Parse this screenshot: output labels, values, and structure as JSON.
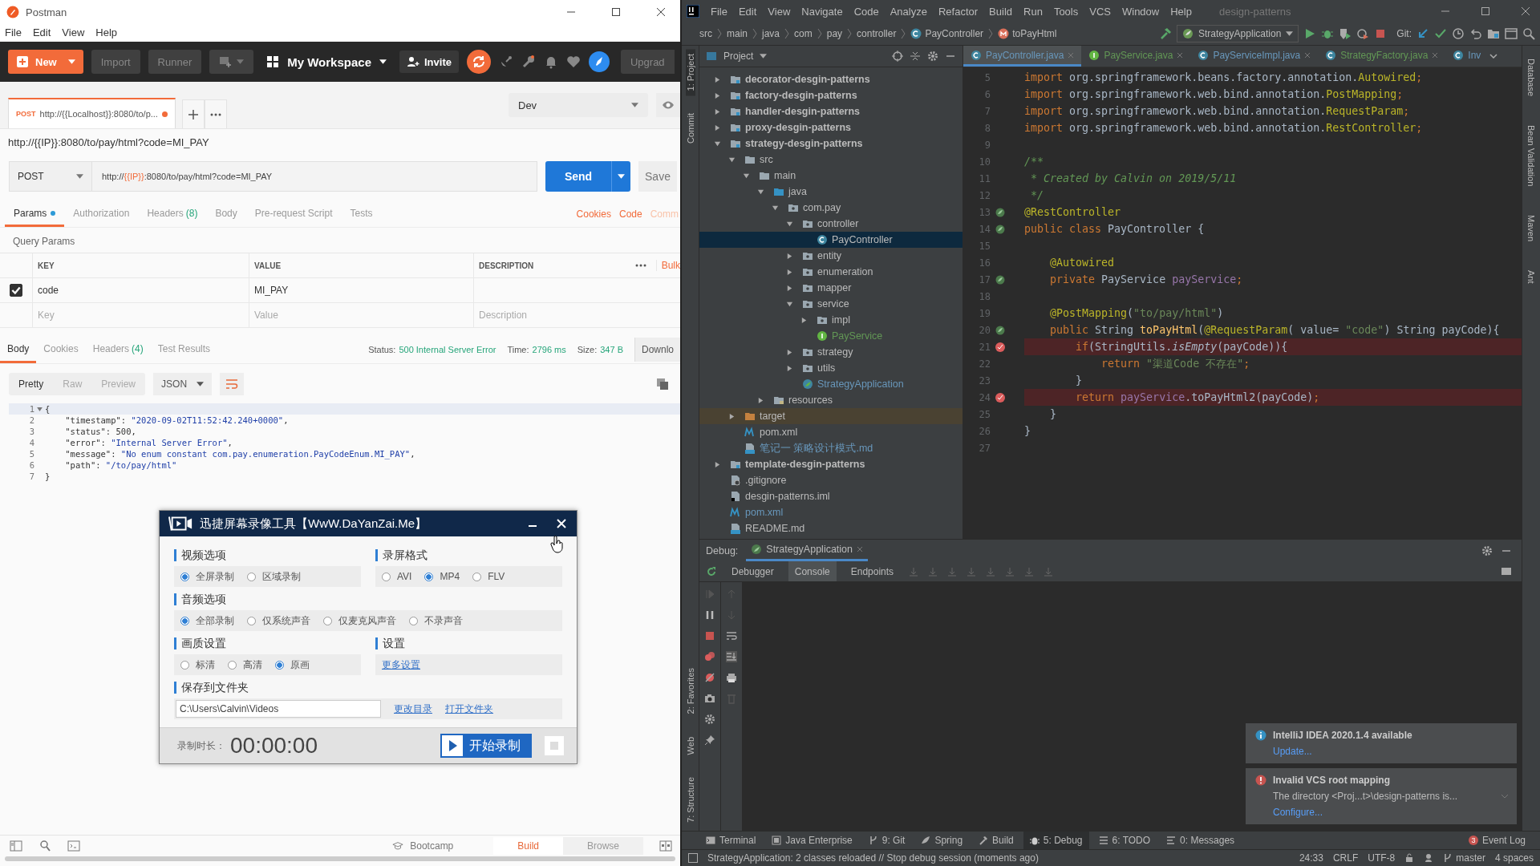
{
  "postman": {
    "window_title": "Postman",
    "menu": [
      "File",
      "Edit",
      "View",
      "Help"
    ],
    "toolbar": {
      "new_label": "New",
      "buttons": [
        "Import",
        "Runner"
      ],
      "workspace": "My Workspace",
      "invite": "Invite",
      "upgrade": "Upgrad"
    },
    "request_tabs": [
      {
        "method": "POST",
        "url": "http://{{Localhost}}:8080/to/p...",
        "unsaved": true,
        "selected": true
      }
    ],
    "environment": "Dev",
    "request_title": "http://{{IP}}:8080/to/pay/html?code=MI_PAY",
    "method": "POST",
    "url": [
      {
        "text": "http://",
        "kind": "plain"
      },
      {
        "text": "{{IP}}",
        "kind": "variable"
      },
      {
        "text": ":8080/to/pay/html?code=MI_PAY",
        "kind": "plain"
      }
    ],
    "send": "Send",
    "save": "Save",
    "option_tabs": [
      {
        "label": "Params",
        "dot": true,
        "selected": true
      },
      {
        "label": "Authorization",
        "dot": false,
        "selected": false
      },
      {
        "label": "Headers",
        "count": "(8)",
        "dot": false,
        "selected": false
      },
      {
        "label": "Body",
        "dot": false,
        "selected": false
      },
      {
        "label": "Pre-request Script",
        "dot": false,
        "selected": false
      },
      {
        "label": "Tests",
        "dot": false,
        "selected": false
      }
    ],
    "option_links": [
      "Cookies",
      "Code",
      "Comm"
    ],
    "query_params": {
      "title": "Query Params",
      "columns": [
        "KEY",
        "VALUE",
        "DESCRIPTION"
      ],
      "bulk_edit": "Bulk",
      "rows": [
        {
          "checked": true,
          "key": "code",
          "value": "MI_PAY"
        }
      ],
      "new_row": {
        "key": {
          "placeholder": "Key"
        },
        "value": {
          "placeholder": "Value"
        },
        "description": {
          "placeholder": "Description"
        }
      }
    },
    "response_tabs": [
      {
        "label": "Body",
        "selected": true
      },
      {
        "label": "Cookies",
        "selected": false
      },
      {
        "label": "Headers",
        "count": "(4)",
        "selected": false
      },
      {
        "label": "Test Results",
        "selected": false
      }
    ],
    "response_meta": [
      {
        "label": "Status:",
        "value": "500 Internal Server Error"
      },
      {
        "label": "Time:",
        "value": "2796 ms"
      },
      {
        "label": "Size:",
        "value": "347 B"
      }
    ],
    "download": "Downlo",
    "view_modes": [
      {
        "label": "Pretty",
        "selected": true
      },
      {
        "label": "Raw",
        "selected": false
      },
      {
        "label": "Preview",
        "selected": false
      }
    ],
    "format": "JSON",
    "response_lines": [
      {
        "number": "1",
        "foldable": true,
        "tokens": [
          {
            "text": "{",
            "kind": "plain"
          }
        ]
      },
      {
        "number": "2",
        "tokens": [
          {
            "text": "    \"timestamp\": ",
            "kind": "key"
          },
          {
            "text": "\"2020-09-02T11:52:42.240+0000\"",
            "kind": "string"
          },
          {
            "text": ",",
            "kind": "plain"
          }
        ]
      },
      {
        "number": "3",
        "tokens": [
          {
            "text": "    \"status\": ",
            "kind": "key"
          },
          {
            "text": "500",
            "kind": "number"
          },
          {
            "text": ",",
            "kind": "plain"
          }
        ]
      },
      {
        "number": "4",
        "tokens": [
          {
            "text": "    \"error\": ",
            "kind": "key"
          },
          {
            "text": "\"Internal Server Error\"",
            "kind": "string"
          },
          {
            "text": ",",
            "kind": "plain"
          }
        ]
      },
      {
        "number": "5",
        "tokens": [
          {
            "text": "    \"message\": ",
            "kind": "key"
          },
          {
            "text": "\"No enum constant com.pay.enumeration.PayCodeEnum.MI_PAY\"",
            "kind": "string"
          },
          {
            "text": ",",
            "kind": "plain"
          }
        ]
      },
      {
        "number": "6",
        "tokens": [
          {
            "text": "    \"path\": ",
            "kind": "key"
          },
          {
            "text": "\"/to/pay/html\"",
            "kind": "string"
          }
        ]
      },
      {
        "number": "7",
        "tokens": [
          {
            "text": "}",
            "kind": "plain"
          }
        ]
      }
    ],
    "footer": {
      "bootcamp": "Bootcamp",
      "modes": [
        {
          "label": "Build",
          "selected": true
        },
        {
          "label": "Browse",
          "selected": false
        }
      ]
    }
  },
  "recorder": {
    "title": "迅捷屏幕录像工具【WwW.DaYanZai.Me】",
    "sections": [
      {
        "title": "视频选项",
        "kind": "radios",
        "wide": false,
        "options": [
          {
            "label": "全屏录制",
            "selected": true
          },
          {
            "label": "区域录制",
            "selected": false
          }
        ]
      },
      {
        "title": "录屏格式",
        "kind": "radios",
        "wide": false,
        "options": [
          {
            "label": "AVI",
            "selected": false
          },
          {
            "label": "MP4",
            "selected": true
          },
          {
            "label": "FLV",
            "selected": false
          }
        ]
      },
      {
        "title": "音频选项",
        "kind": "radios",
        "wide": true,
        "options": [
          {
            "label": "全部录制",
            "selected": true
          },
          {
            "label": "仅系统声音",
            "selected": false
          },
          {
            "label": "仅麦克风声音",
            "selected": false
          },
          {
            "label": "不录声音",
            "selected": false
          }
        ]
      },
      {
        "title": "画质设置",
        "kind": "radios",
        "wide": false,
        "options": [
          {
            "label": "标清",
            "selected": false
          },
          {
            "label": "高清",
            "selected": false
          },
          {
            "label": "原画",
            "selected": true
          }
        ]
      },
      {
        "title": "设置",
        "kind": "links",
        "wide": false,
        "links": [
          "更多设置"
        ]
      },
      {
        "title": "保存到文件夹",
        "kind": "folder",
        "wide": true,
        "path": "C:\\Users\\Calvin\\Videos",
        "links": [
          "更改目录",
          "打开文件夹"
        ]
      }
    ],
    "duration_label": "录制时长：",
    "duration": "00:00:00",
    "start": "开始录制"
  },
  "ide": {
    "menu": [
      "File",
      "Edit",
      "View",
      "Navigate",
      "Code",
      "Analyze",
      "Refactor",
      "Build",
      "Run",
      "Tools",
      "VCS",
      "Window",
      "Help"
    ],
    "project_name": "design-patterns",
    "breadcrumbs": [
      {
        "text": "src",
        "kind": "folder"
      },
      {
        "text": "main",
        "kind": "folder"
      },
      {
        "text": "java",
        "kind": "folder"
      },
      {
        "text": "com",
        "kind": "folder"
      },
      {
        "text": "pay",
        "kind": "folder"
      },
      {
        "text": "controller",
        "kind": "folder"
      },
      {
        "text": "PayController",
        "kind": "class"
      },
      {
        "text": "toPayHtml",
        "kind": "method"
      }
    ],
    "run_config": "StrategyApplication",
    "git_label": "Git:",
    "left_tools_top": [
      {
        "label": "1: Project",
        "selected": true
      },
      {
        "label": "Commit",
        "selected": false
      }
    ],
    "left_tools_bottom": [
      "2: Favorites",
      "Web",
      "7: Structure"
    ],
    "project_panel": {
      "title": "Project",
      "tree": [
        {
          "name": "decorator-desgin-patterns",
          "kind": "module",
          "expanded": false,
          "selected": false
        },
        {
          "name": "factory-desgin-patterns",
          "kind": "module",
          "expanded": false,
          "selected": false
        },
        {
          "name": "handler-desgin-patterns",
          "kind": "module",
          "expanded": false,
          "selected": false
        },
        {
          "name": "proxy-desgin-patterns",
          "kind": "module",
          "expanded": false,
          "selected": false
        },
        {
          "name": "strategy-desgin-patterns",
          "kind": "module",
          "expanded": true,
          "selected": false,
          "children": [
            {
              "name": "src",
              "kind": "folder",
              "expanded": true,
              "selected": false,
              "children": [
                {
                  "name": "main",
                  "kind": "folder",
                  "expanded": true,
                  "selected": false,
                  "children": [
                    {
                      "name": "java",
                      "kind": "source",
                      "expanded": true,
                      "selected": false,
                      "children": [
                        {
                          "name": "com.pay",
                          "kind": "package",
                          "expanded": true,
                          "selected": false,
                          "children": [
                            {
                              "name": "controller",
                              "kind": "package",
                              "expanded": true,
                              "selected": false,
                              "children": [
                                {
                                  "name": "PayController",
                                  "kind": "class",
                                  "selected": true
                                }
                              ]
                            },
                            {
                              "name": "entity",
                              "kind": "package",
                              "expanded": false,
                              "selected": false
                            },
                            {
                              "name": "enumeration",
                              "kind": "package",
                              "expanded": false,
                              "selected": false
                            },
                            {
                              "name": "mapper",
                              "kind": "package",
                              "expanded": false,
                              "selected": false
                            },
                            {
                              "name": "service",
                              "kind": "package",
                              "expanded": true,
                              "selected": false,
                              "children": [
                                {
                                  "name": "impl",
                                  "kind": "package",
                                  "expanded": false,
                                  "selected": false
                                },
                                {
                                  "name": "PayService",
                                  "kind": "interface",
                                  "color": "#629755",
                                  "selected": false
                                }
                              ]
                            },
                            {
                              "name": "strategy",
                              "kind": "package",
                              "expanded": false,
                              "selected": false
                            },
                            {
                              "name": "utils",
                              "kind": "package",
                              "expanded": false,
                              "selected": false
                            },
                            {
                              "name": "StrategyApplication",
                              "kind": "spring-app",
                              "color": "#6897bb",
                              "selected": false
                            }
                          ]
                        }
                      ]
                    },
                    {
                      "name": "resources",
                      "kind": "resources",
                      "expanded": false,
                      "selected": false
                    }
                  ]
                }
              ]
            },
            {
              "name": "target",
              "kind": "excluded",
              "expanded": false,
              "selected": false
            },
            {
              "name": "pom.xml",
              "kind": "maven",
              "selected": false
            },
            {
              "name": "笔记一 策略设计模式.md",
              "kind": "markdown",
              "color": "#6897bb",
              "selected": false
            }
          ]
        },
        {
          "name": "template-desgin-patterns",
          "kind": "module",
          "expanded": false,
          "selected": false
        },
        {
          "name": ".gitignore",
          "kind": "ignore",
          "selected": false
        },
        {
          "name": "desgin-patterns.iml",
          "kind": "iml",
          "selected": false
        },
        {
          "name": "pom.xml",
          "kind": "maven",
          "color": "#6897bb",
          "selected": false
        },
        {
          "name": "README.md",
          "kind": "markdown",
          "selected": false
        }
      ]
    },
    "editor_tabs": [
      {
        "label": "PayController.java",
        "kind": "class",
        "color": "#6897bb",
        "selected": true
      },
      {
        "label": "PayService.java",
        "kind": "interface",
        "color": "#629755",
        "selected": false
      },
      {
        "label": "PayServiceImpl.java",
        "kind": "class",
        "color": "#6897bb",
        "selected": false
      },
      {
        "label": "StrategyFactory.java",
        "kind": "class",
        "color": "#629755",
        "selected": false
      },
      {
        "label": "Inv",
        "kind": "class",
        "color": "#6897bb",
        "selected": false
      }
    ],
    "code_lines": [
      {
        "number": "5",
        "tokens": [
          {
            "text": "import ",
            "kind": "keyword"
          },
          {
            "text": "org.springframework.beans.factory.annotation.",
            "kind": "plain"
          },
          {
            "text": "Autowired",
            "kind": "annotation"
          },
          {
            "text": ";",
            "kind": "keyword"
          }
        ]
      },
      {
        "number": "6",
        "tokens": [
          {
            "text": "import ",
            "kind": "keyword"
          },
          {
            "text": "org.springframework.web.bind.annotation.",
            "kind": "plain"
          },
          {
            "text": "PostMapping",
            "kind": "annotation"
          },
          {
            "text": ";",
            "kind": "keyword"
          }
        ]
      },
      {
        "number": "7",
        "tokens": [
          {
            "text": "import ",
            "kind": "keyword"
          },
          {
            "text": "org.springframework.web.bind.annotation.",
            "kind": "plain"
          },
          {
            "text": "RequestParam",
            "kind": "annotation"
          },
          {
            "text": ";",
            "kind": "keyword"
          }
        ]
      },
      {
        "number": "8",
        "tokens": [
          {
            "text": "import ",
            "kind": "keyword"
          },
          {
            "text": "org.springframework.web.bind.annotation.",
            "kind": "plain"
          },
          {
            "text": "RestController",
            "kind": "annotation"
          },
          {
            "text": ";",
            "kind": "keyword"
          }
        ]
      },
      {
        "number": "9"
      },
      {
        "number": "10",
        "tokens": [
          {
            "text": "/**",
            "kind": "comment"
          }
        ]
      },
      {
        "number": "11",
        "tokens": [
          {
            "text": " * Created by Calvin on 2019/5/11",
            "kind": "comment"
          }
        ]
      },
      {
        "number": "12",
        "tokens": [
          {
            "text": " */",
            "kind": "comment"
          }
        ]
      },
      {
        "number": "13",
        "kind": "bean",
        "tokens": [
          {
            "text": "@RestController",
            "kind": "annotation"
          }
        ]
      },
      {
        "number": "14",
        "kind": "bean",
        "tokens": [
          {
            "text": "public class ",
            "kind": "keyword"
          },
          {
            "text": "PayController {",
            "kind": "plain"
          }
        ]
      },
      {
        "number": "15"
      },
      {
        "number": "16",
        "tokens": [
          {
            "text": "    @Autowired",
            "kind": "annotation"
          }
        ]
      },
      {
        "number": "17",
        "kind": "bean",
        "tokens": [
          {
            "text": "    private ",
            "kind": "keyword"
          },
          {
            "text": "PayService ",
            "kind": "plain"
          },
          {
            "text": "payService",
            "kind": "field"
          },
          {
            "text": ";",
            "kind": "keyword"
          }
        ]
      },
      {
        "number": "18"
      },
      {
        "number": "19",
        "tokens": [
          {
            "text": "    @PostMapping",
            "kind": "annotation"
          },
          {
            "text": "(",
            "kind": "plain"
          },
          {
            "text": "\"to/pay/html\"",
            "kind": "string"
          },
          {
            "text": ")",
            "kind": "plain"
          }
        ]
      },
      {
        "number": "20",
        "kind": "bean",
        "tokens": [
          {
            "text": "    public ",
            "kind": "keyword"
          },
          {
            "text": "String ",
            "kind": "plain"
          },
          {
            "text": "toPayHtml",
            "kind": "method"
          },
          {
            "text": "(",
            "kind": "plain"
          },
          {
            "text": "@RequestParam",
            "kind": "annotation"
          },
          {
            "text": "( value= ",
            "kind": "plain"
          },
          {
            "text": "\"code\"",
            "kind": "string"
          },
          {
            "text": ") String payCode){",
            "kind": "plain"
          }
        ]
      },
      {
        "number": "21",
        "kind": "breakpoint",
        "tokens": [
          {
            "text": "        if",
            "kind": "keyword"
          },
          {
            "text": "(StringUtils.",
            "kind": "plain"
          },
          {
            "text": "isEmpty",
            "kind": "static"
          },
          {
            "text": "(payCode)){",
            "kind": "plain"
          }
        ]
      },
      {
        "number": "22",
        "tokens": [
          {
            "text": "            return ",
            "kind": "keyword"
          },
          {
            "text": "\"渠道Code 不存在\"",
            "kind": "string"
          },
          {
            "text": ";",
            "kind": "keyword"
          }
        ]
      },
      {
        "number": "23",
        "tokens": [
          {
            "text": "        }",
            "kind": "plain"
          }
        ]
      },
      {
        "number": "24",
        "kind": "breakpoint",
        "tokens": [
          {
            "text": "        return ",
            "kind": "keyword"
          },
          {
            "text": "payService",
            "kind": "field"
          },
          {
            "text": ".toPayHtml2(payCode)",
            "kind": "plain"
          },
          {
            "text": ";",
            "kind": "keyword"
          }
        ]
      },
      {
        "number": "25",
        "tokens": [
          {
            "text": "    }",
            "kind": "plain"
          }
        ]
      },
      {
        "number": "26",
        "tokens": [
          {
            "text": "}",
            "kind": "plain"
          }
        ]
      },
      {
        "number": "27"
      }
    ],
    "right_tools": [
      "Database",
      "Bean Validation",
      "Maven",
      "Ant"
    ],
    "debug": {
      "label": "Debug:",
      "session": "StrategyApplication",
      "tabs": [
        {
          "label": "Debugger",
          "selected": false
        },
        {
          "label": "Console",
          "selected": true
        },
        {
          "label": "Endpoints",
          "selected": false
        }
      ]
    },
    "notifications": [
      {
        "kind": "info",
        "title": "IntelliJ IDEA 2020.1.4 available",
        "link": "Update..."
      },
      {
        "kind": "error",
        "title": "Invalid VCS root mapping",
        "body": "The directory <Proj...t>\\design-patterns is...",
        "link": "Configure..."
      }
    ],
    "tool_tabs": [
      {
        "label": "Terminal",
        "kind": "terminal",
        "selected": false
      },
      {
        "label": "Java Enterprise",
        "kind": "enterprise",
        "selected": false
      },
      {
        "label": "9: Git",
        "kind": "git",
        "selected": false
      },
      {
        "label": "Spring",
        "kind": "spring",
        "selected": false
      },
      {
        "label": "Build",
        "kind": "build",
        "selected": false
      },
      {
        "label": "5: Debug",
        "kind": "debug",
        "selected": true
      },
      {
        "label": "6: TODO",
        "kind": "todo",
        "selected": false
      },
      {
        "label": "0: Messages",
        "kind": "messages",
        "selected": false
      }
    ],
    "event_log": {
      "label": "Event Log",
      "count": "3"
    },
    "status": {
      "message": "StrategyApplication: 2 classes reloaded // Stop debug session (moments ago)",
      "items": [
        "24:33",
        "CRLF",
        "UTF-8"
      ],
      "branch": "master",
      "indent": "4 spaces"
    }
  }
}
